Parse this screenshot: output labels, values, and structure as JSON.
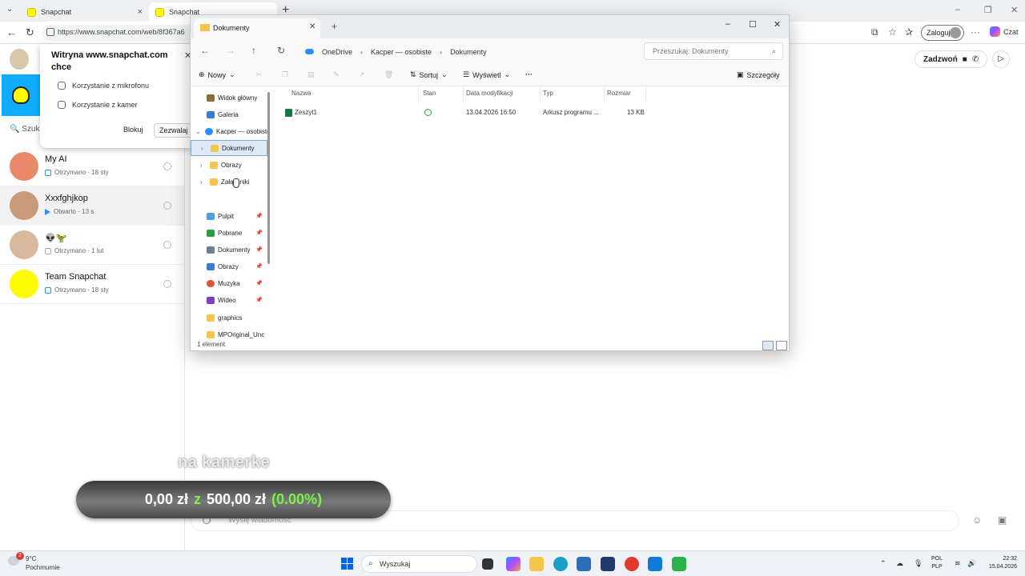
{
  "browser": {
    "tabs": [
      {
        "label": "Snapchat"
      },
      {
        "label": "Snapchat"
      }
    ],
    "url": "https://www.snapchat.com/web/8f367a6",
    "login_label": "Zaloguj",
    "copilot_label": "Czat"
  },
  "permission": {
    "title": "Witryna www.snapchat.com chce",
    "items": [
      "Korzystanie z mikrofonu",
      "Korzystanie z kamer"
    ],
    "block_label": "Blokuj",
    "allow_label": "Zezwalaj"
  },
  "snapchat": {
    "search_partial": "Szuk",
    "chats": [
      {
        "name": "My AI",
        "status": "Otrzymano · 18 sty"
      },
      {
        "name": "Xxxfghjkop",
        "status": "Otwarto · 13 s"
      },
      {
        "name": "👽🦖",
        "status": "Otrzymano · 1 lut"
      },
      {
        "name": "Team Snapchat",
        "status": "Otrzymano · 18 sty"
      }
    ],
    "call_label": "Zadzwoń",
    "message_placeholder": "Wyślij wiadomość"
  },
  "overlay": {
    "caption": "na kamerke",
    "amount": "0,00 zł",
    "of": "z",
    "goal": "500,00 zł",
    "percent": "(0.00%)",
    "progress_fraction": 0.0
  },
  "explorer": {
    "tab_title": "Dokumenty",
    "breadcrumbs": [
      "OneDrive",
      "Kacper — osobiste",
      "Dokumenty"
    ],
    "search_placeholder": "Przeszukaj: Dokumenty",
    "toolbar": {
      "new": "Nowy",
      "sort": "Sortuj",
      "view": "Wyświetl",
      "more": "···",
      "details": "Szczegóły"
    },
    "sidebar": [
      {
        "label": "Widok główny",
        "icon": "home-icon",
        "color": "#8a6d3b"
      },
      {
        "label": "Galeria",
        "icon": "gallery-icon",
        "color": "#3a7bd5"
      },
      {
        "label": "Kacper — osobiste",
        "icon": "cloud-icon",
        "color": "#2b8cff"
      },
      {
        "label": "Dokumenty",
        "icon": "folder-icon",
        "color": "#f4c64b"
      },
      {
        "label": "Obrazy",
        "icon": "folder-icon",
        "color": "#f4c64b"
      },
      {
        "label": "Załączniki",
        "icon": "folder-icon",
        "color": "#f4c64b"
      },
      {
        "label": "Pulpit",
        "icon": "desktop-icon",
        "color": "#4aa3df"
      },
      {
        "label": "Pobrane",
        "icon": "download-icon",
        "color": "#2a9d3e"
      },
      {
        "label": "Dokumenty",
        "icon": "document-icon",
        "color": "#6b7f99"
      },
      {
        "label": "Obrazy",
        "icon": "pictures-icon",
        "color": "#3a7bd5"
      },
      {
        "label": "Muzyka",
        "icon": "music-icon",
        "color": "#e0532f"
      },
      {
        "label": "Wideo",
        "icon": "video-icon",
        "color": "#7b3fbf"
      },
      {
        "label": "graphics",
        "icon": "folder-icon",
        "color": "#f4c64b"
      },
      {
        "label": "MPOriginal_Unc",
        "icon": "folder-icon",
        "color": "#f4c64b"
      }
    ],
    "columns": [
      "Nazwa",
      "Stan",
      "Data modyfikacji",
      "Typ",
      "Rozmiar"
    ],
    "files": [
      {
        "name": "Zeszyt1",
        "modified": "13.04.2026 16:50",
        "type": "Arkusz programu ...",
        "size": "13 KB"
      }
    ],
    "status": "1 element"
  },
  "taskbar": {
    "temp": "9°C",
    "weather": "Pochmurnie",
    "weather_badge": "2",
    "search": "Wyszukaj",
    "lang1": "POL",
    "lang2": "PLP",
    "time": "22:32",
    "date": "15.04.2026"
  },
  "colors": {
    "snap_yellow": "#fffc00",
    "snap_blue": "#0fadff",
    "progress_green": "#7cf14b",
    "selection": "#dce9f7"
  }
}
